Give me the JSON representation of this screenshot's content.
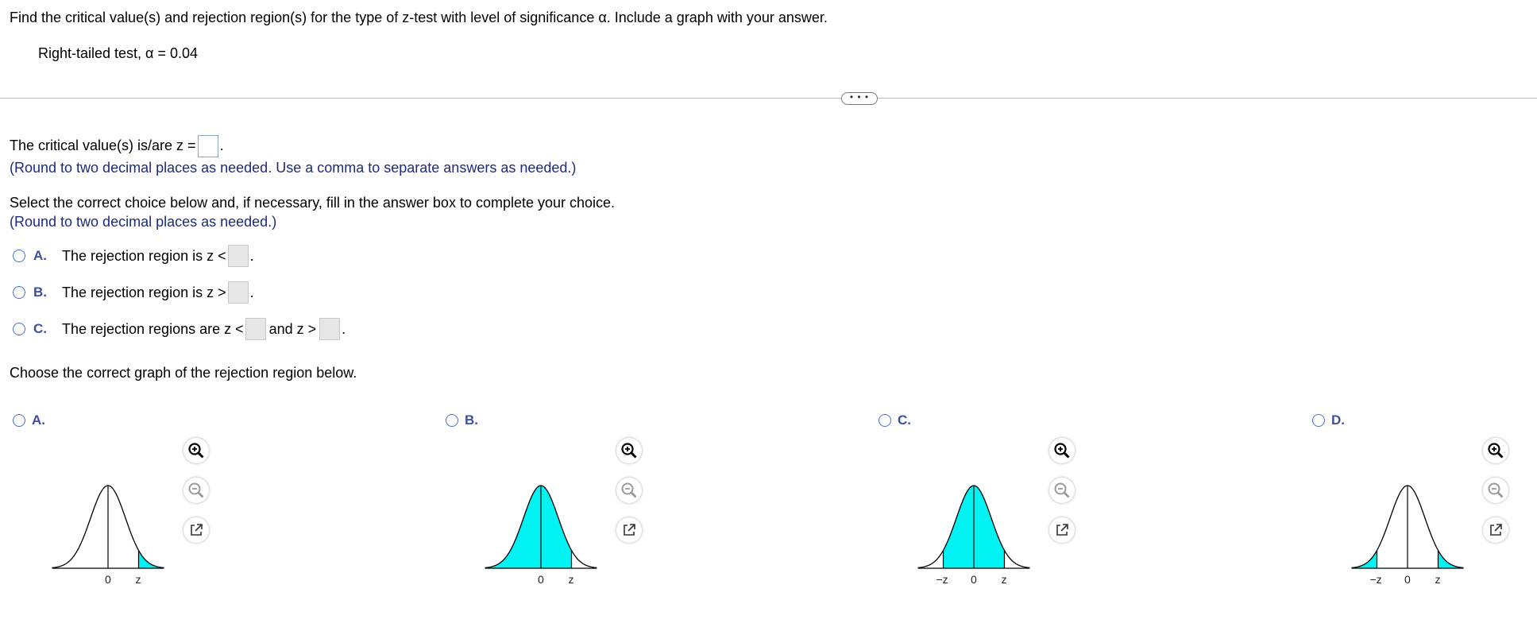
{
  "question": {
    "prompt": "Find the critical value(s) and rejection region(s) for the type of z-test with level of significance α. Include a graph with your answer.",
    "test": "Right-tailed test, α = 0.04"
  },
  "more_button": "• • •",
  "part1": {
    "label": "The critical value(s) is/are z =",
    "hint": "(Round to two decimal places as needed. Use a comma to separate answers as needed.)"
  },
  "part2": {
    "instruction": "Select the correct choice below and, if necessary, fill in the answer box to complete your choice.",
    "hint": "(Round to two decimal places as needed.)",
    "choices": [
      {
        "letter": "A.",
        "text": "The rejection region is z <"
      },
      {
        "letter": "B.",
        "text": "The rejection region is z >"
      },
      {
        "letter": "C.",
        "text_before": "The rejection regions are z <",
        "text_mid": "and z >"
      }
    ]
  },
  "part3": {
    "instruction": "Choose the correct graph of the rejection region below.",
    "graphs": [
      {
        "letter": "A.",
        "shading": "right-tail",
        "labels": [
          "0",
          "z"
        ]
      },
      {
        "letter": "B.",
        "shading": "left-of-z",
        "labels": [
          "0",
          "z"
        ]
      },
      {
        "letter": "C.",
        "shading": "between-z",
        "labels": [
          "−z",
          "0",
          "z"
        ]
      },
      {
        "letter": "D.",
        "shading": "two-tails",
        "labels": [
          "−z",
          "0",
          "z"
        ]
      }
    ]
  },
  "colors": {
    "fill": "#00f2f2",
    "accent": "#3a4fa8",
    "hint": "#1f2a7a"
  },
  "tool_icons": [
    "zoom-in-icon",
    "zoom-out-icon",
    "popout-icon"
  ]
}
